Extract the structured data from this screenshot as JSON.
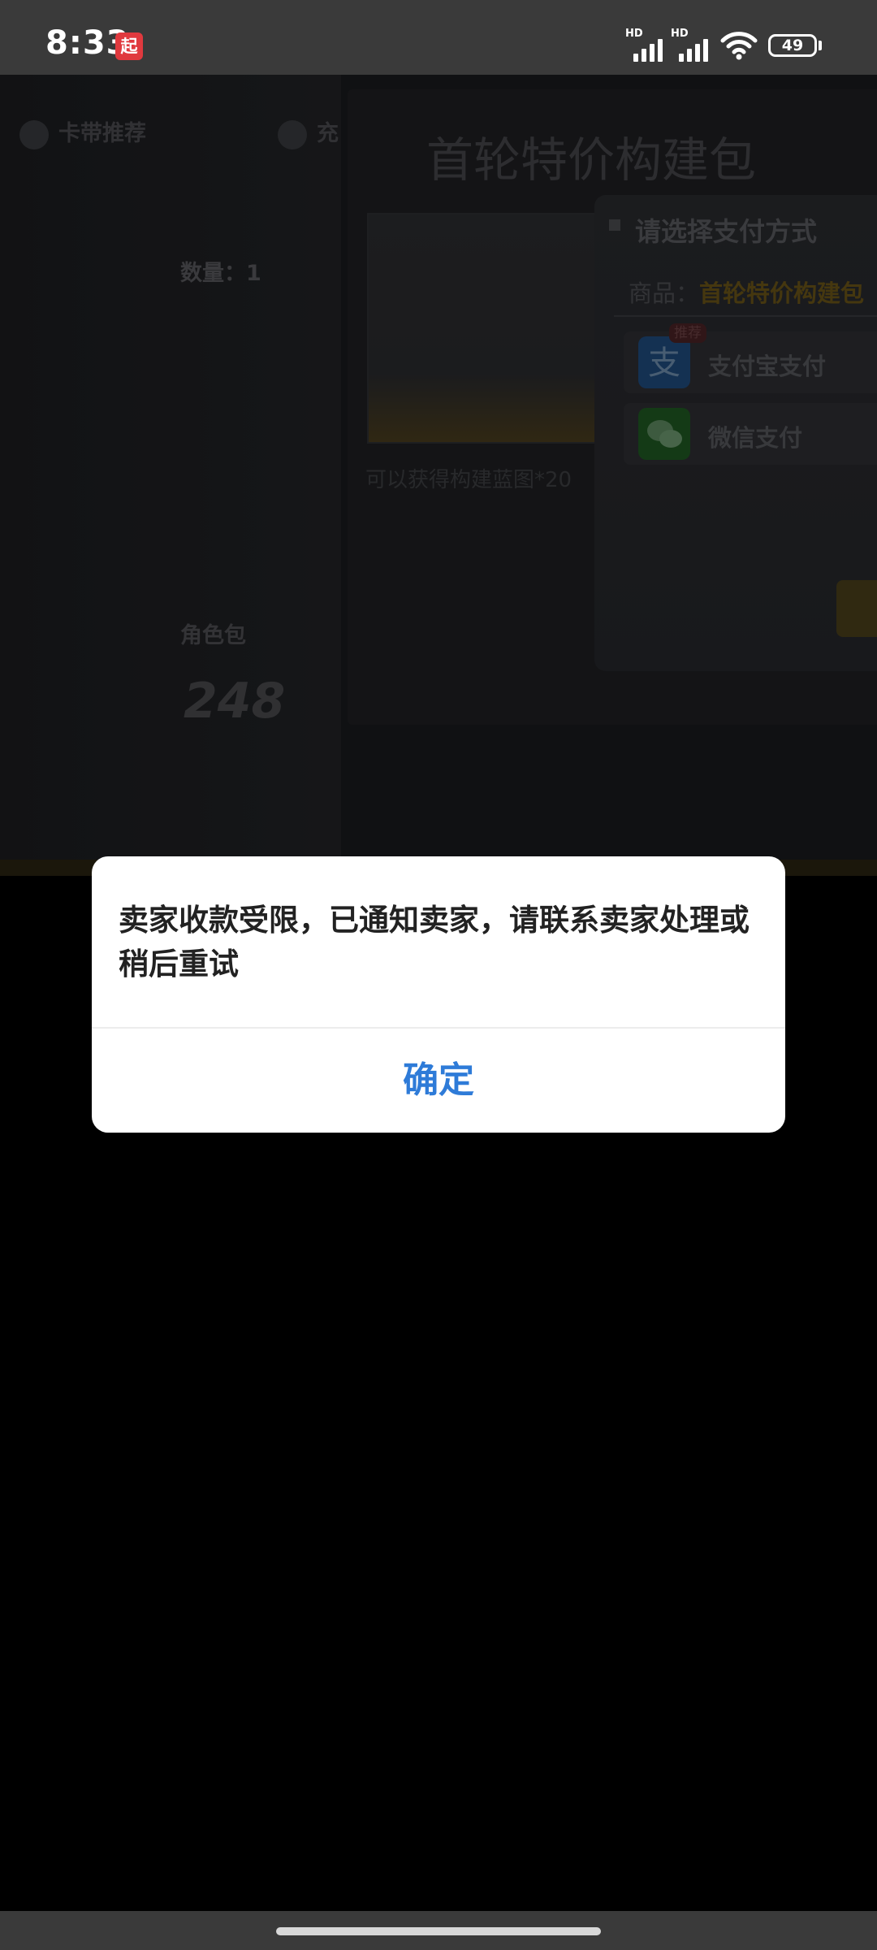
{
  "status_bar": {
    "time": "8:33",
    "app_badge": "起",
    "signal_1_label": "HD",
    "signal_2_label": "HD",
    "battery_level": "49"
  },
  "background_app": {
    "tab_1_label": "卡带推荐",
    "tab_2_label": "充",
    "count_label": "数量：1",
    "pack_title": "角色包",
    "price": "248",
    "panel_title": "首轮特价构建包",
    "panel_desc": "可以获得构建蓝图*20",
    "payment": {
      "title": "请选择支付方式",
      "product_label": "商品：",
      "product_name": "首轮特价构建包",
      "options": [
        {
          "label": "支付宝支付",
          "tag": "推荐",
          "color": "#1677ff"
        },
        {
          "label": "微信支付",
          "tag": "",
          "color": "#1aad19"
        }
      ]
    }
  },
  "dialog": {
    "message": "卖家收款受限，已通知卖家，请联系卖家处理或稍后重试",
    "confirm_label": "确定",
    "confirm_color": "#2e7bd8"
  }
}
